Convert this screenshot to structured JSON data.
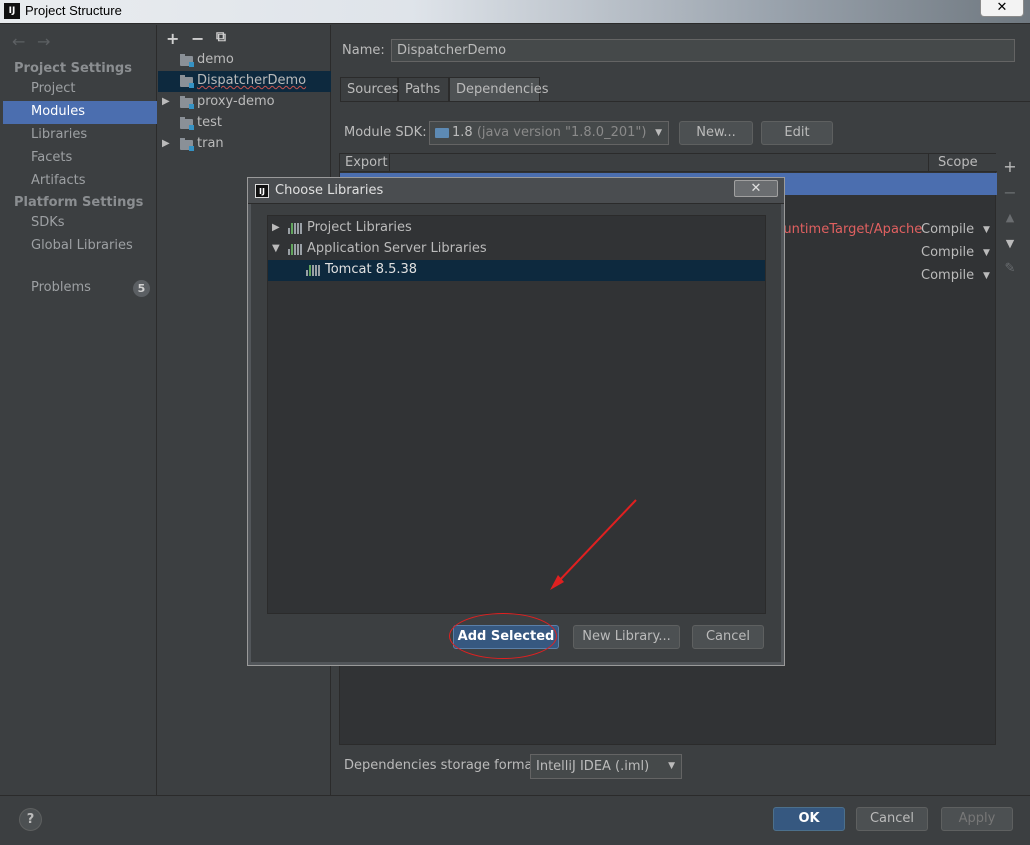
{
  "window": {
    "title": "Project Structure",
    "logo_text": "IJ",
    "close_glyph": "✕"
  },
  "left_nav": {
    "back_arrow": "←",
    "forward_arrow": "→",
    "project_settings_header": "Project Settings",
    "project_settings_items": [
      "Project",
      "Modules",
      "Libraries",
      "Facets",
      "Artifacts"
    ],
    "active_item": "Modules",
    "platform_settings_header": "Platform Settings",
    "platform_settings_items": [
      "SDKs",
      "Global Libraries"
    ],
    "problems_label": "Problems",
    "problems_count": "5"
  },
  "module_tree": {
    "add_glyph": "+",
    "remove_glyph": "−",
    "copy_glyph": "⧉",
    "items": [
      {
        "label": "demo",
        "expandable": false,
        "selected": false
      },
      {
        "label": "DispatcherDemo",
        "expandable": false,
        "selected": true
      },
      {
        "label": "proxy-demo",
        "expandable": true,
        "selected": false
      },
      {
        "label": "test",
        "expandable": false,
        "selected": false
      },
      {
        "label": "tran",
        "expandable": true,
        "selected": false
      }
    ]
  },
  "main": {
    "name_label": "Name:",
    "name_value": "DispatcherDemo",
    "tabs": [
      "Sources",
      "Paths",
      "Dependencies"
    ],
    "active_tab": "Dependencies",
    "sdk_label": "Module SDK:",
    "sdk_value": "1.8",
    "sdk_detail": "(java version \"1.8.0_201\")",
    "new_button": "New...",
    "edit_button": "Edit",
    "table_header_export": "Export",
    "table_header_scope": "Scope",
    "dependency_rows": [
      {
        "name": "runtimeTarget/Apache",
        "scope": "Compile"
      },
      {
        "name": "",
        "scope": "Compile"
      },
      {
        "name": "",
        "scope": "Compile"
      }
    ],
    "side_tools": {
      "add": "+",
      "remove": "−",
      "up": "▲",
      "down": "▼",
      "edit": "✎"
    },
    "storage_label": "Dependencies storage format:",
    "storage_value": "IntelliJ IDEA (.iml)"
  },
  "bottom_bar": {
    "help": "?",
    "ok": "OK",
    "cancel": "Cancel",
    "apply": "Apply"
  },
  "dialog": {
    "title": "Choose Libraries",
    "logo_text": "IJ",
    "close_glyph": "✕",
    "tree": [
      {
        "label": "Project Libraries",
        "expanded": false,
        "level": 0
      },
      {
        "label": "Application Server Libraries",
        "expanded": true,
        "level": 0
      },
      {
        "label": "Tomcat 8.5.38",
        "level": 1,
        "selected": true
      }
    ],
    "add_selected_button": "Add Selected",
    "new_library_button": "New Library...",
    "cancel_button": "Cancel",
    "annotation_color": "#e02020"
  },
  "colors": {
    "selection_blue": "#4b6eaf",
    "tree_selection": "#0d293e",
    "error_red": "#e06060",
    "primary_button": "#365880"
  }
}
